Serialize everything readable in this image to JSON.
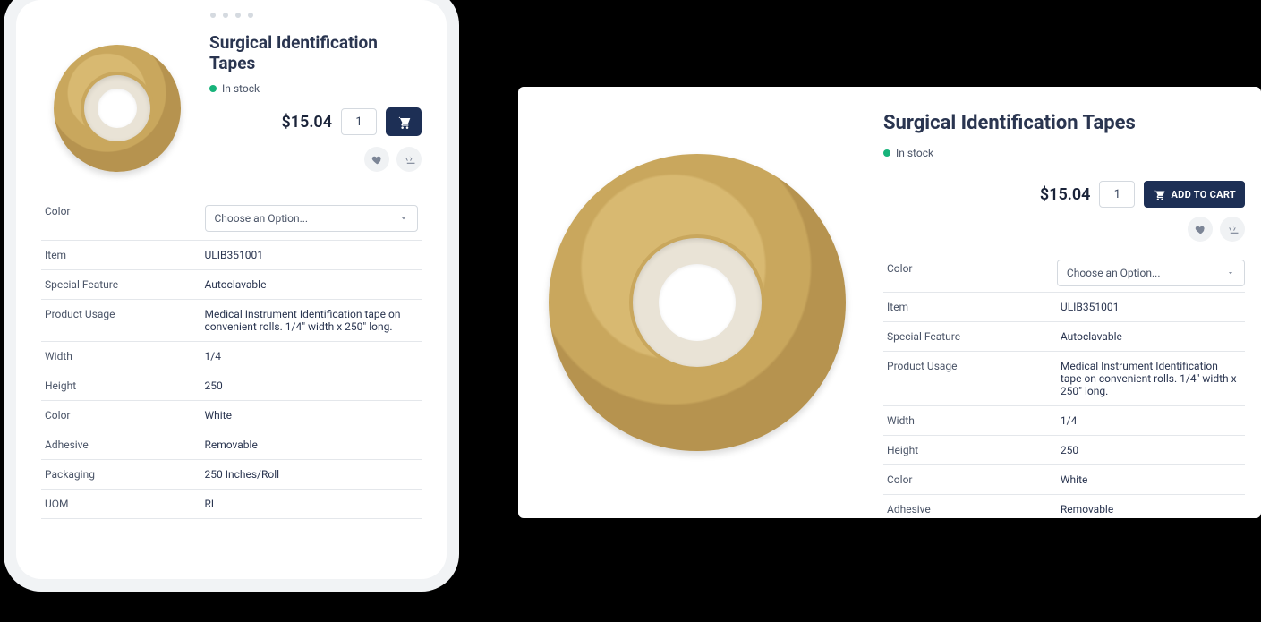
{
  "product": {
    "title": "Surgical Identification Tapes",
    "stock_status": "In stock",
    "price": "$15.04",
    "qty": "1",
    "add_to_cart_label": "ADD TO CART",
    "color_select_placeholder": "Choose an Option...",
    "icons": {
      "cart": "cart-icon",
      "wishlist": "heart-icon",
      "compare": "scale-icon",
      "chevron": "chevron-down-icon"
    }
  },
  "specs": [
    {
      "label": "Color",
      "value": null,
      "is_select": true
    },
    {
      "label": "Item",
      "value": "ULIB351001"
    },
    {
      "label": "Special Feature",
      "value": "Autoclavable"
    },
    {
      "label": "Product Usage",
      "value": "Medical Instrument Identification tape on convenient rolls. 1/4\" width x 250\" long."
    },
    {
      "label": "Width",
      "value": "1/4"
    },
    {
      "label": "Height",
      "value": "250"
    },
    {
      "label": "Color",
      "value": "White"
    },
    {
      "label": "Adhesive",
      "value": "Removable"
    },
    {
      "label": "Packaging",
      "value": "250 Inches/Roll"
    },
    {
      "label": "UOM",
      "value": "RL"
    }
  ]
}
